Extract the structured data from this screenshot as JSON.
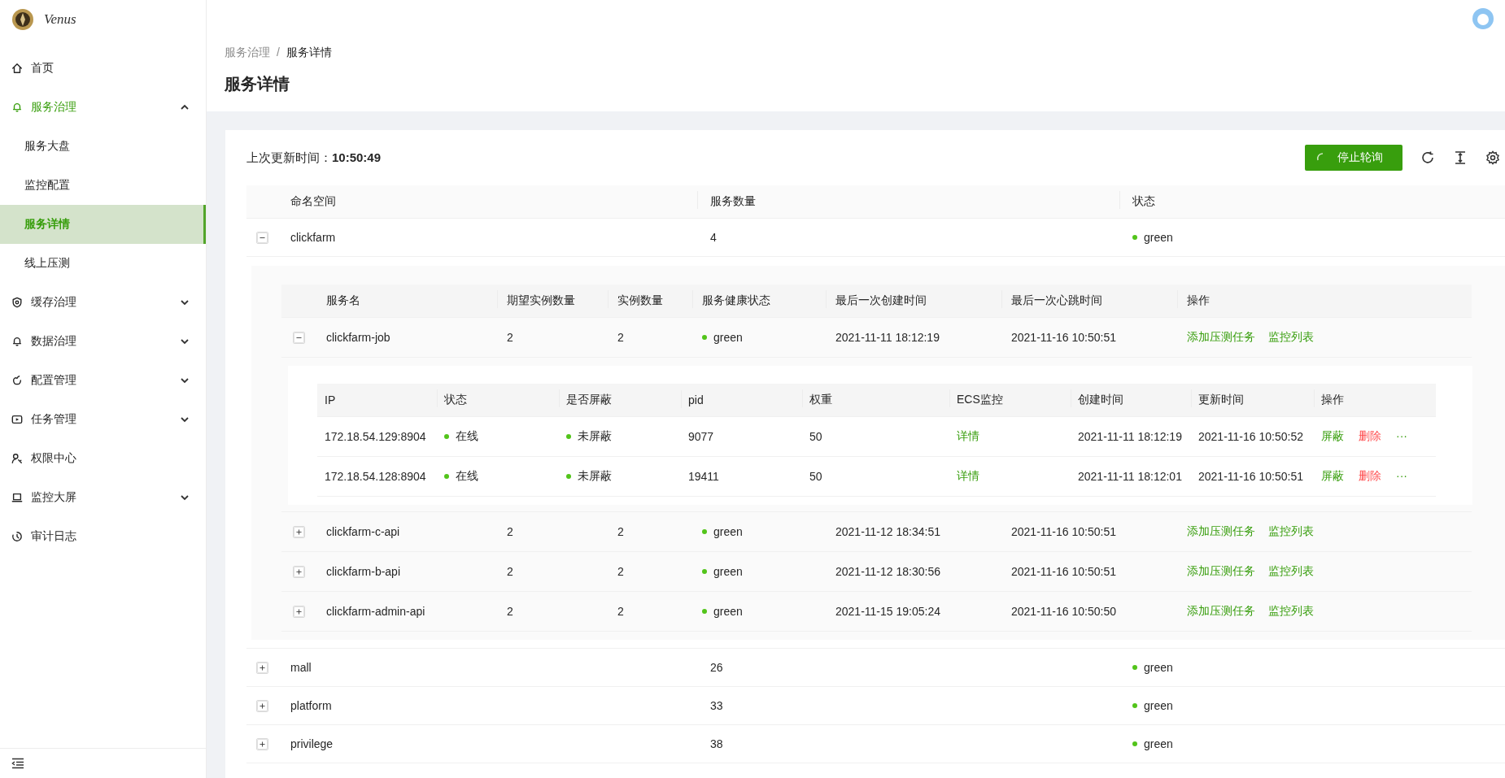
{
  "logo": {
    "text": "Venus"
  },
  "sidebar": {
    "items": [
      {
        "label": "首页",
        "kind": "link",
        "selected": false
      },
      {
        "label": "服务治理",
        "kind": "group",
        "expanded": true,
        "selected": false,
        "children": [
          {
            "label": "服务大盘",
            "selected": false
          },
          {
            "label": "监控配置",
            "selected": false
          },
          {
            "label": "服务详情",
            "selected": true
          },
          {
            "label": "线上压测",
            "selected": false
          }
        ]
      },
      {
        "label": "缓存治理",
        "kind": "group",
        "expanded": false,
        "selected": false
      },
      {
        "label": "数据治理",
        "kind": "group",
        "expanded": false,
        "selected": false
      },
      {
        "label": "配置管理",
        "kind": "group",
        "expanded": false,
        "selected": false
      },
      {
        "label": "任务管理",
        "kind": "group",
        "expanded": false,
        "selected": false
      },
      {
        "label": "权限中心",
        "kind": "link",
        "selected": false
      },
      {
        "label": "监控大屏",
        "kind": "group",
        "expanded": false,
        "selected": false
      },
      {
        "label": "审计日志",
        "kind": "link",
        "selected": false
      }
    ]
  },
  "breadcrumb": {
    "items": [
      "服务治理",
      "服务详情"
    ],
    "separator": "/"
  },
  "page_title": "服务详情",
  "toolbar": {
    "last_update_label": "上次更新时间：",
    "last_update_value": "10:50:49",
    "button": {
      "label": "停止轮询",
      "loading": true
    }
  },
  "table": {
    "columns": [
      "命名空间",
      "服务数量",
      "状态"
    ],
    "rows": [
      {
        "expanded": true,
        "namespace": "clickfarm",
        "count": "4",
        "status": "green",
        "color": "#52c41a",
        "services": {
          "columns": [
            "服务名",
            "期望实例数量",
            "实例数量",
            "服务健康状态",
            "最后一次创建时间",
            "最后一次心跳时间",
            "操作"
          ],
          "rows": [
            {
              "expanded": true,
              "name": "clickfarm-job",
              "expected": "2",
              "instances": "2",
              "health": "green",
              "color": "#52c41a",
              "created": "2021-11-11 18:12:19",
              "heartbeat": "2021-11-16 10:50:51",
              "actions": [
                "添加压测任务",
                "监控列表"
              ],
              "nodes": {
                "columns": [
                  "IP",
                  "状态",
                  "是否屏蔽",
                  "pid",
                  "权重",
                  "ECS监控",
                  "创建时间",
                  "更新时间",
                  "操作"
                ],
                "rows": [
                  {
                    "ip": "172.18.54.129:8904",
                    "status": {
                      "text": "在线",
                      "color": "#52c41a"
                    },
                    "masked": {
                      "text": "未屏蔽",
                      "color": "#52c41a"
                    },
                    "pid": "9077",
                    "weight": "50",
                    "ecs": "详情",
                    "created": "2021-11-11 18:12:19",
                    "updated": "2021-11-16 10:50:52",
                    "actions": [
                      {
                        "label": "屏蔽",
                        "kind": "normal"
                      },
                      {
                        "label": "删除",
                        "kind": "danger"
                      }
                    ],
                    "more": "···"
                  },
                  {
                    "ip": "172.18.54.128:8904",
                    "status": {
                      "text": "在线",
                      "color": "#52c41a"
                    },
                    "masked": {
                      "text": "未屏蔽",
                      "color": "#52c41a"
                    },
                    "pid": "19411",
                    "weight": "50",
                    "ecs": "详情",
                    "created": "2021-11-11 18:12:01",
                    "updated": "2021-11-16 10:50:51",
                    "actions": [
                      {
                        "label": "屏蔽",
                        "kind": "normal"
                      },
                      {
                        "label": "删除",
                        "kind": "danger"
                      }
                    ],
                    "more": "···"
                  }
                ]
              }
            },
            {
              "expanded": false,
              "name": "clickfarm-c-api",
              "expected": "2",
              "instances": "2",
              "health": "green",
              "color": "#52c41a",
              "created": "2021-11-12 18:34:51",
              "heartbeat": "2021-11-16 10:50:51",
              "actions": [
                "添加压测任务",
                "监控列表"
              ]
            },
            {
              "expanded": false,
              "name": "clickfarm-b-api",
              "expected": "2",
              "instances": "2",
              "health": "green",
              "color": "#52c41a",
              "created": "2021-11-12 18:30:56",
              "heartbeat": "2021-11-16 10:50:51",
              "actions": [
                "添加压测任务",
                "监控列表"
              ]
            },
            {
              "expanded": false,
              "name": "clickfarm-admin-api",
              "expected": "2",
              "instances": "2",
              "health": "green",
              "color": "#52c41a",
              "created": "2021-11-15 19:05:24",
              "heartbeat": "2021-11-16 10:50:50",
              "actions": [
                "添加压测任务",
                "监控列表"
              ]
            }
          ]
        }
      },
      {
        "expanded": false,
        "namespace": "mall",
        "count": "26",
        "status": "green",
        "color": "#52c41a"
      },
      {
        "expanded": false,
        "namespace": "platform",
        "count": "33",
        "status": "green",
        "color": "#52c41a"
      },
      {
        "expanded": false,
        "namespace": "privilege",
        "count": "38",
        "status": "green",
        "color": "#52c41a"
      }
    ]
  }
}
